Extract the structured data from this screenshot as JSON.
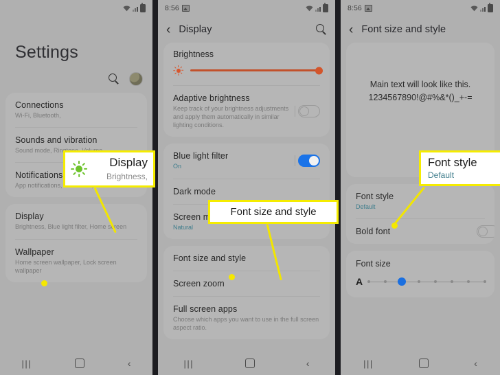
{
  "panels": {
    "settings": {
      "status": {
        "time": "",
        "wifi_icon": "wifi-icon",
        "signal_icon": "signal-icon",
        "battery_icon": "battery-icon"
      },
      "title": "Settings",
      "search_icon": "search-icon",
      "avatar": "account-avatar",
      "items": [
        {
          "title": "Connections",
          "subtitle": "Wi-Fi, Bluetooth, "
        },
        {
          "title": "Sounds and vibration",
          "subtitle": "Sound mode, Ringtone, Volume"
        },
        {
          "title": "Notifications",
          "subtitle": "App notifications, Status bar, Do not disturb"
        },
        {
          "title": "Display",
          "subtitle": "Brightness, Blue light filter, Home screen"
        },
        {
          "title": "Wallpaper",
          "subtitle": "Home screen wallpaper, Lock screen wallpaper"
        }
      ],
      "nav": {
        "recent": "|||",
        "home": "home-button",
        "back": "‹"
      }
    },
    "display": {
      "status": {
        "time": "8:56",
        "image_icon": "image-icon",
        "wifi_icon": "wifi-icon",
        "signal_icon": "signal-icon",
        "battery_icon": "battery-icon"
      },
      "back_icon": "back-arrow-icon",
      "title": "Display",
      "search_icon": "search-icon",
      "brightness": {
        "label": "Brightness",
        "icon": "brightness-sun-icon",
        "value": 100
      },
      "adaptive": {
        "title": "Adaptive brightness",
        "subtitle": "Keep track of your brightness adjustments and apply them automatically in similar lighting conditions.",
        "toggle": "off"
      },
      "blue_light": {
        "title": "Blue light filter",
        "subtitle": "On",
        "toggle": "on"
      },
      "dark_mode": {
        "title": "Dark mode"
      },
      "screen_mode": {
        "title": "Screen mode",
        "subtitle": "Natural"
      },
      "font_size_style": {
        "title": "Font size and style"
      },
      "screen_zoom": {
        "title": "Screen zoom"
      },
      "full_screen_apps": {
        "title": "Full screen apps",
        "subtitle": "Choose which apps you want to use in the full screen aspect ratio."
      },
      "nav": {
        "recent": "|||",
        "home": "home-button",
        "back": "‹"
      }
    },
    "font": {
      "status": {
        "time": "8:56",
        "image_icon": "image-icon",
        "wifi_icon": "wifi-icon",
        "signal_icon": "signal-icon",
        "battery_icon": "battery-icon"
      },
      "back_icon": "back-arrow-icon",
      "title": "Font size and style",
      "preview_line1": "Main text will look like this.",
      "preview_line2": "1234567890!@#%&*()_+-=",
      "font_style": {
        "title": "Font style",
        "subtitle": "Default"
      },
      "bold_font": {
        "title": "Bold font",
        "toggle": "off"
      },
      "font_size": {
        "label": "Font size",
        "marker": "A",
        "steps": 8,
        "selected_index": 2
      },
      "nav": {
        "recent": "|||",
        "home": "home-button",
        "back": "‹"
      }
    }
  },
  "callouts": {
    "display": {
      "title": "Display",
      "subtitle": "Brightness,",
      "icon": "brightness-sun-icon"
    },
    "font_size_style": {
      "title": "Font size and style"
    },
    "font_style": {
      "title": "Font style",
      "subtitle": "Default"
    }
  },
  "colors": {
    "highlight": "#f5ec00",
    "accent_blue": "#1a73e8",
    "brightness_orange": "#d3552b",
    "sun_green": "#6dc22b",
    "link_blue": "#3f7d8c"
  }
}
